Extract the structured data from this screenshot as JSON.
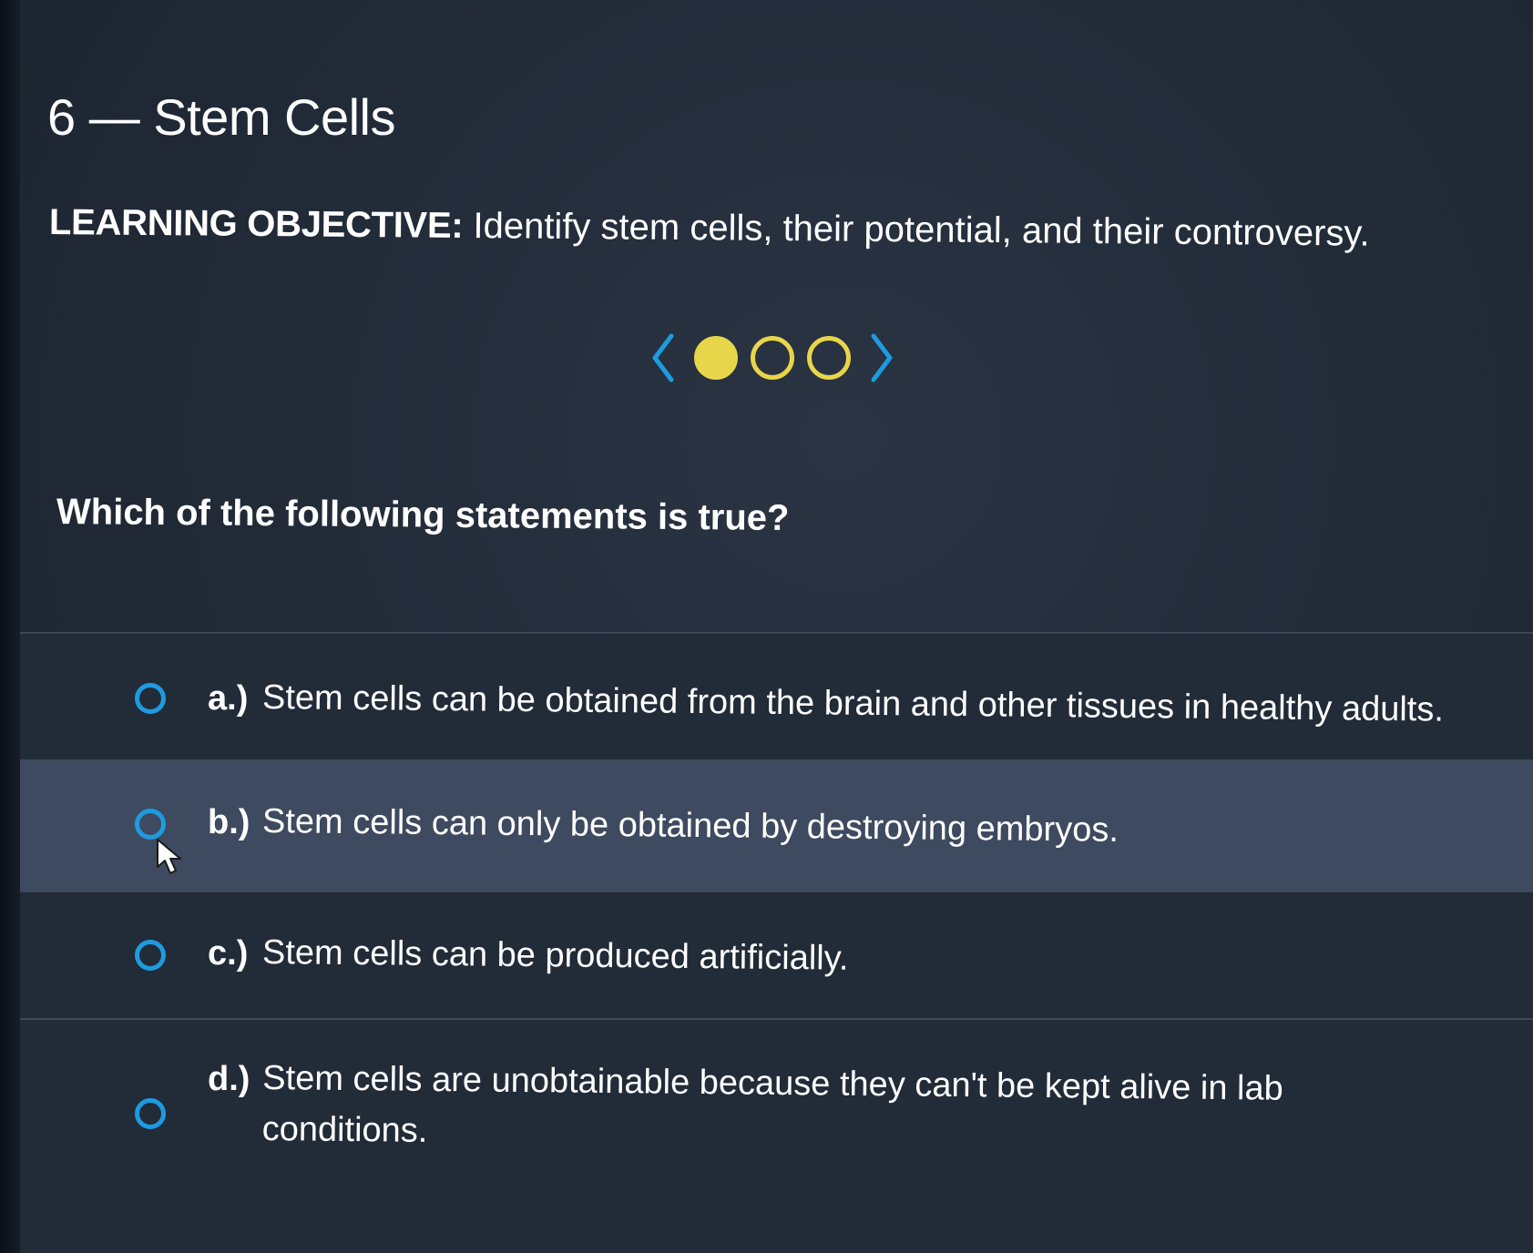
{
  "lesson": {
    "title": "6 — Stem Cells"
  },
  "objective": {
    "label": "LEARNING OBJECTIVE:",
    "text": "Identify stem cells, their potential, and their controversy."
  },
  "pager": {
    "total": 3,
    "current": 1,
    "prev_icon": "chevron-left-icon",
    "next_icon": "chevron-right-icon"
  },
  "question": {
    "text": "Which of the following statements is true?"
  },
  "options": [
    {
      "letter": "a.)",
      "text": "Stem cells can be obtained from the brain and other tissues in healthy adults."
    },
    {
      "letter": "b.)",
      "text": "Stem cells can only be obtained by destroying embryos."
    },
    {
      "letter": "c.)",
      "text": "Stem cells can be produced artificially."
    },
    {
      "letter": "d.)",
      "text": "Stem cells are unobtainable because they can't be kept alive in lab conditions."
    }
  ],
  "colors": {
    "background": "#222b38",
    "hover_row": "#3e4a5f",
    "radio": "#1e9be0",
    "pager_dot": "#e8d64a",
    "pager_arrow": "#1e9be0"
  }
}
